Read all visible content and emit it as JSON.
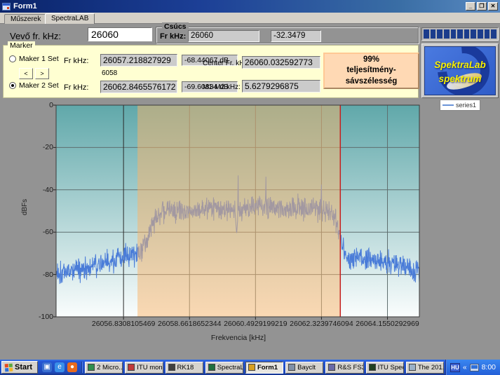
{
  "window": {
    "title": "Form1",
    "minimize": "_",
    "restore": "❐",
    "close": "✕"
  },
  "tabs": [
    {
      "label": "Műszerek",
      "active": false
    },
    {
      "label": "SpectraLAB",
      "active": true
    }
  ],
  "receiver": {
    "label": "Vevő fr. kHz:",
    "value": "26060"
  },
  "peak": {
    "group_label": "Csúcs",
    "fr_label": "Fr kHz:",
    "fr_value": "26060",
    "level_value": "-32.3479"
  },
  "marker": {
    "group_label": "Marker",
    "marker1": {
      "radio_label": "Maker 1 Set",
      "fr_label": "Fr kHz:",
      "freq": "26057.218827929",
      "level": "-68.44067 dB",
      "checked": false
    },
    "marker2": {
      "radio_label": "Maker 2 Set",
      "fr_label": "Fr kHz:",
      "freq": "26062.8465576172",
      "level": "-69.60834 dB",
      "checked": true
    },
    "step_label": "6058",
    "prev_button": "<",
    "next_button": ">",
    "center": {
      "label": "Center Fr. kHz:",
      "value": "26060.032592773"
    },
    "delta": {
      "label": "M1-M2 kHz:",
      "value": "5.6279296875"
    },
    "bandwidth_button_line1": "99%",
    "bandwidth_button_line2": "teljesítmény-sávszélesség"
  },
  "progress": {
    "segments": 11,
    "color": "#1b3c8c"
  },
  "logo": {
    "line1": "SpektraLab",
    "line2": "spektrum"
  },
  "chart_data": {
    "type": "line",
    "xlabel": "Frekvencia [kHz]",
    "ylabel": "dBFs",
    "xlim": [
      26054.96,
      26065.04
    ],
    "ylim": [
      -100,
      0
    ],
    "x_ticks": [
      26056.8308105469,
      26058.6618652344,
      26060.4929199219,
      26062.3239746094,
      26064.1550292969
    ],
    "x_tick_labels": [
      "26056.8308105469",
      "26058.6618652344",
      "26060.4929199219",
      "26062.3239746094",
      "26064.1550292969"
    ],
    "y_ticks": [
      0,
      -20,
      -40,
      -60,
      -80,
      -100
    ],
    "y_tick_labels": [
      "0",
      "-20",
      "-40",
      "-60",
      "-80",
      "-100"
    ],
    "grid": true,
    "legend": {
      "label": "series1",
      "position": "top-right"
    },
    "series": [
      {
        "name": "series1",
        "color": "#4a7cd8"
      }
    ],
    "envelope_points": [
      [
        26054.96,
        -79
      ],
      [
        26055.6,
        -77.5
      ],
      [
        26056.2,
        -75
      ],
      [
        26056.7,
        -72.5
      ],
      [
        26057.0,
        -71
      ],
      [
        26057.25,
        -70
      ],
      [
        26057.35,
        -68
      ],
      [
        26057.5,
        -61
      ],
      [
        26057.65,
        -55
      ],
      [
        26057.85,
        -51
      ],
      [
        26058.1,
        -49.5
      ],
      [
        26058.6,
        -49
      ],
      [
        26059.2,
        -48.5
      ],
      [
        26059.8,
        -48.5
      ],
      [
        26060.0,
        -49
      ],
      [
        26060.5,
        -48
      ],
      [
        26061.2,
        -48
      ],
      [
        26061.8,
        -48.5
      ],
      [
        26062.3,
        -49
      ],
      [
        26062.55,
        -50
      ],
      [
        26062.7,
        -53
      ],
      [
        26062.85,
        -62
      ],
      [
        26062.95,
        -70
      ],
      [
        26063.1,
        -72.5
      ],
      [
        26063.4,
        -71.5
      ],
      [
        26063.8,
        -73
      ],
      [
        26064.3,
        -75
      ],
      [
        26064.7,
        -76.5
      ],
      [
        26065.04,
        -79
      ]
    ],
    "spikes": [
      [
        26060.01,
        -33.2
      ],
      [
        26060.78,
        -33.8
      ],
      [
        26062.32,
        -37.5
      ]
    ],
    "dip": {
      "x": 26059.97,
      "depth_db": -61,
      "width_khz": 0.05
    },
    "noise_db": 2.6,
    "band_region": {
      "from": 26057.218827929,
      "to": 26062.8465576172,
      "fill": "rgba(249,179,105,0.5)"
    },
    "marker_line": {
      "x": 26062.8465576172,
      "color": "#c42020"
    },
    "plot_gradient_top": "#60a8aa",
    "plot_gradient_bottom": "#fafdfd"
  },
  "taskbar": {
    "start_label": "Start",
    "quick_launch": [
      {
        "name": "app-icon",
        "color": "#3a6fd0",
        "glyph": "▣"
      },
      {
        "name": "ie-icon",
        "color": "#3a8fe8",
        "glyph": "e"
      },
      {
        "name": "firefox-icon",
        "color": "#e86a1e",
        "glyph": "●"
      }
    ],
    "buttons": [
      {
        "label": "2 Micro...",
        "dropdown": "▾",
        "active": false,
        "icon": "#2f8f4f"
      },
      {
        "label": "ITU moni...",
        "dropdown": "",
        "active": false,
        "icon": "#c03a3a"
      },
      {
        "label": "RK18",
        "dropdown": "",
        "active": false,
        "icon": "#404040"
      },
      {
        "label": "SpectraL...",
        "dropdown": "",
        "active": false,
        "icon": "#1f6f3f"
      },
      {
        "label": "Form1",
        "dropdown": "",
        "active": true,
        "icon": "#d8a020"
      },
      {
        "label": "Bayclt",
        "dropdown": "",
        "active": false,
        "icon": "#8090a8"
      },
      {
        "label": "R&S FS3...",
        "dropdown": "",
        "active": false,
        "icon": "#6a6aa8"
      },
      {
        "label": "ITU Spec...",
        "dropdown": "",
        "active": false,
        "icon": "#204020"
      },
      {
        "label": "The 201...",
        "dropdown": "",
        "active": false,
        "icon": "#9ab0c8"
      }
    ],
    "tray": {
      "lang": "HU",
      "chevron": "«",
      "clock": "8:00"
    }
  }
}
